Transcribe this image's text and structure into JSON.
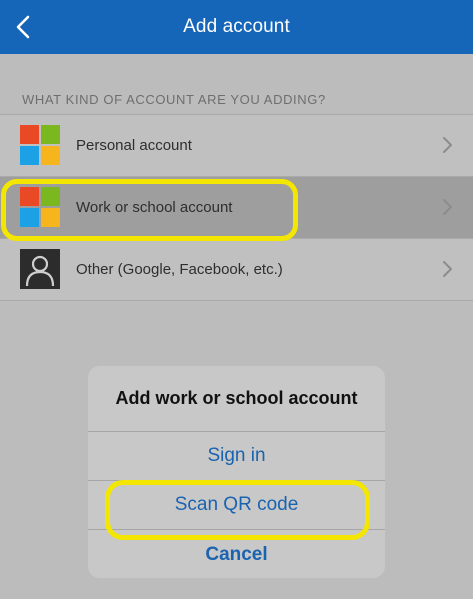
{
  "header": {
    "title": "Add account",
    "back_icon": "chevron-left-icon",
    "background": "#1565b8"
  },
  "section": {
    "label": "WHAT KIND OF ACCOUNT ARE YOU ADDING?"
  },
  "accounts": [
    {
      "label": "Personal account",
      "icon": "microsoft-logo-icon",
      "selected": false
    },
    {
      "label": "Work or school account",
      "icon": "microsoft-logo-icon",
      "selected": true
    },
    {
      "label": "Other (Google, Facebook, etc.)",
      "icon": "person-icon",
      "selected": false
    }
  ],
  "sheet": {
    "title": "Add work or school account",
    "sign_in": "Sign in",
    "scan_qr": "Scan QR code",
    "cancel": "Cancel"
  },
  "colors": {
    "highlight": "#f3e600",
    "action_blue": "#1a63b0",
    "ms_red": "#e94a25",
    "ms_green": "#7bb81f",
    "ms_blue": "#1da1e6",
    "ms_yellow": "#f6b51d"
  }
}
